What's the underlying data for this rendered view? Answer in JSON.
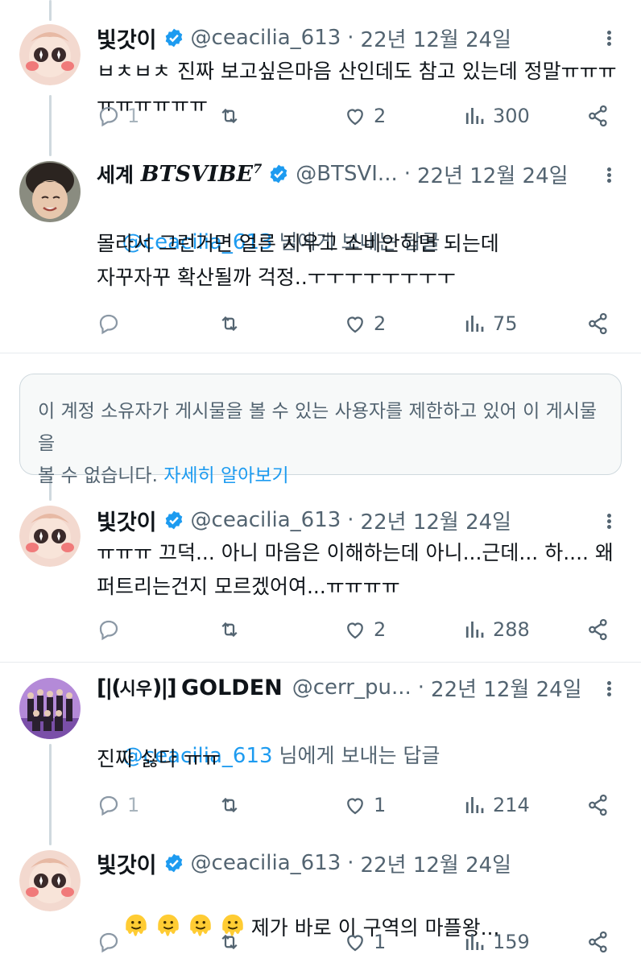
{
  "tweets": [
    {
      "name": "빛갓이",
      "handle": "@ceacilia_613",
      "date": "22년 12월 24일",
      "text": "ㅂㅊㅂㅊ 진짜 보고싶은마음 산인데도 참고 있는데 정말ㅠㅠㅠㅠㅠㅠㅠㅠㅠ",
      "replies": "1",
      "retweets": "",
      "likes": "2",
      "views": "300"
    },
    {
      "name": "세계 BTSVIBE⁷",
      "handle": "@BTSVI...",
      "date": "22년 12월 24일",
      "reply_to": "@ceacilia_613",
      "reply_suffix": " 님에게 보내는 답글",
      "text": "몰라서 그런거면 얼른 지우고 소비안하면 되는데\n자꾸자꾸 확산될까 걱정..ㅜㅜㅜㅜㅜㅜㅜㅜ",
      "replies": "",
      "retweets": "",
      "likes": "2",
      "views": "75"
    },
    {
      "name": "빛갓이",
      "handle": "@ceacilia_613",
      "date": "22년 12월 24일",
      "text": "ㅠㅠㅠ 끄덕... 아니 마음은 이해하는데 아니...근데... 하.... 왜\n퍼트리는건지 모르겠어여...ㅠㅠㅠㅠ",
      "replies": "",
      "retweets": "",
      "likes": "2",
      "views": "288"
    },
    {
      "name": "🇦시우🇦 GOLDEN",
      "name_main": "GOLDEN",
      "name_prefix": "시우",
      "handle": "@cerr_pu...",
      "date": "22년 12월 24일",
      "reply_to": "@ceacilia_613",
      "reply_suffix": " 님에게 보내는 답글",
      "text": "진짜 싫다 ㅠㅠ",
      "replies": "1",
      "retweets": "",
      "likes": "1",
      "views": "214"
    },
    {
      "name": "빛갓이",
      "handle": "@ceacilia_613",
      "date": "22년 12월 24일",
      "text": "제가 바로 이 구역의 마플왕...",
      "replies": "",
      "retweets": "",
      "likes": "1",
      "views": "159"
    }
  ],
  "notice": {
    "text": "이 계정 소유자가 게시물을 볼 수 있는 사용자를 제한하고 있어 이 게시물을\n볼 수 없습니다. ",
    "link": "자세히 알아보기"
  },
  "colors": {
    "accent": "#1d9bf0",
    "secondary_text": "#536471",
    "divider": "#e7ebee"
  },
  "icons": [
    "reply-icon",
    "retweet-icon",
    "like-icon",
    "views-icon",
    "share-icon",
    "more-icon",
    "verified-badge-icon"
  ]
}
